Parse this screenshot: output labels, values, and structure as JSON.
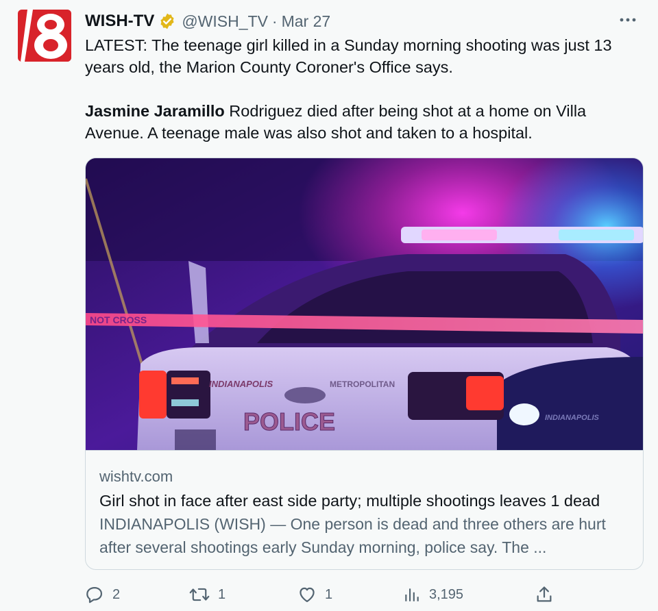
{
  "account": {
    "name": "WISH-TV",
    "handle": "@WISH_TV",
    "separator": "·",
    "date": "Mar 27",
    "avatar_icon": "wish-tv-8-logo",
    "verified_color": "#e2b719"
  },
  "tweet": {
    "paragraph1": "LATEST: The teenage girl killed in a Sunday morning shooting was just 13 years old, the Marion County Coroner's Office says.",
    "paragraph2_bold": "Jasmine Jaramillo",
    "paragraph2_rest": " Rodriguez died after being shot at a home on Villa Avenue. A teenage male was also shot and taken to a hospital."
  },
  "card": {
    "domain": "wishtv.com",
    "title": "Girl shot in face after east side party; multiple shootings leaves 1 dead",
    "description": "INDIANAPOLIS (WISH) — One person is dead and three others are hurt after several shootings early Sunday morning, police say. The ...",
    "image": {
      "crime_tape": "NOT CROSS",
      "car_text_1": "INDIANAPOLIS",
      "car_text_2": "METROPOLITAN",
      "car_text_3": "POLICE",
      "car_text_4": "INDIANAPOLIS"
    }
  },
  "actions": {
    "replies": "2",
    "retweets": "1",
    "likes": "1",
    "views": "3,195"
  },
  "colors": {
    "text": "#0f1419",
    "secondary": "#536471",
    "background": "#f7f9f9",
    "border": "#cfd9de",
    "brand_red": "#d8232a"
  }
}
